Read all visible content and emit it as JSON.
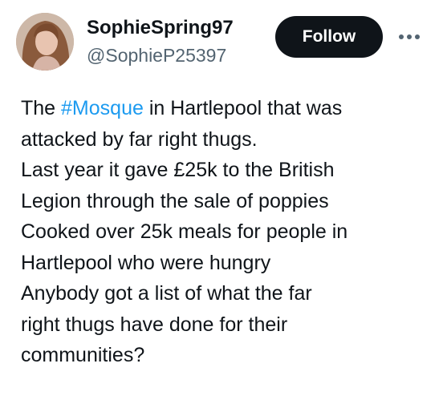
{
  "user": {
    "display_name": "SophieSpring97",
    "handle": "@SophieP25397",
    "avatar_icon": "profile-photo"
  },
  "actions": {
    "follow_label": "Follow",
    "more_icon": "more-horizontal-icon"
  },
  "colors": {
    "hashtag": "#1d9bf0",
    "follow_bg": "#0f1419",
    "handle": "#536471"
  },
  "tweet": {
    "lines": [
      {
        "before": "The ",
        "hashtag": "#Mosque",
        "after": " in Hartlepool that was"
      },
      {
        "text": "attacked by far right thugs."
      },
      {
        "text": "Last year it gave £25k to the British"
      },
      {
        "text": "Legion through the sale of poppies"
      },
      {
        "text": "Cooked over 25k meals for people in"
      },
      {
        "text": "Hartlepool who were hungry"
      },
      {
        "text": "Anybody got a list of what the far"
      },
      {
        "text": "right thugs have done for their"
      },
      {
        "text": "communities?"
      }
    ]
  }
}
